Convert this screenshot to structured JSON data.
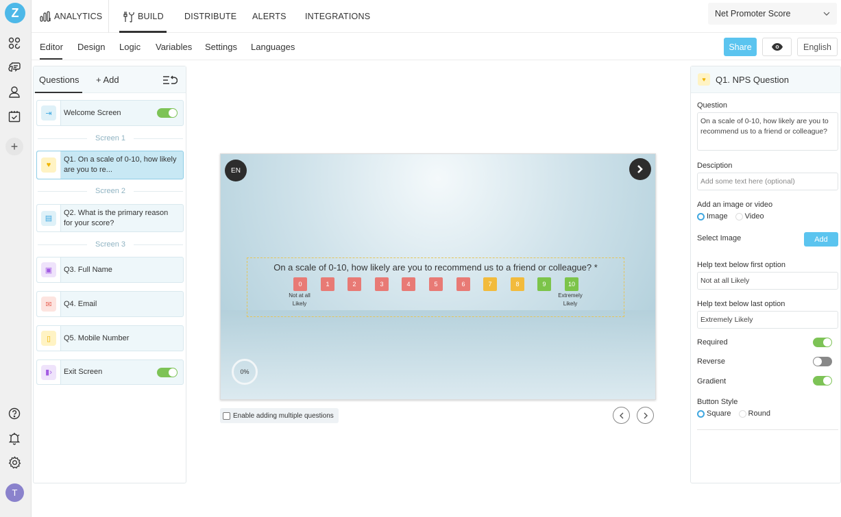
{
  "rail": {
    "logo_letter": "Z",
    "icons": [
      "dashboard-icon",
      "feedback-icon",
      "contacts-icon",
      "tasks-icon",
      "add-icon",
      "help-icon",
      "notifications-icon",
      "settings-icon"
    ],
    "avatar_initial": "T"
  },
  "topnav": {
    "items": [
      {
        "label": "ANALYTICS",
        "icon": "analytics-icon"
      },
      {
        "label": "BUILD",
        "icon": "build-tools-icon",
        "active": true
      },
      {
        "label": "DISTRIBUTE"
      },
      {
        "label": "ALERTS"
      },
      {
        "label": "INTEGRATIONS"
      }
    ],
    "survey_select": {
      "value": "Net Promoter Score"
    }
  },
  "subnav": {
    "tabs": [
      {
        "label": "Editor",
        "active": true
      },
      {
        "label": "Design"
      },
      {
        "label": "Logic"
      },
      {
        "label": "Variables"
      },
      {
        "label": "Settings"
      },
      {
        "label": "Languages"
      }
    ],
    "share_label": "Share",
    "language_label": "English"
  },
  "questions_panel": {
    "tab_questions": "Questions",
    "tab_add": "+ Add",
    "items": [
      {
        "label": "Welcome Screen",
        "icon": "welcome-icon",
        "toggle": true
      },
      {
        "divider": "Screen 1"
      },
      {
        "label": "Q1. On a scale of 0-10, how likely are you to re...",
        "icon": "heart-icon",
        "selected": true
      },
      {
        "divider": "Screen 2"
      },
      {
        "label": "Q2. What is the primary reason for your score?",
        "icon": "text-box-icon"
      },
      {
        "divider": "Screen 3"
      },
      {
        "label": "Q3. Full Name",
        "icon": "id-card-icon"
      },
      {
        "label": "Q4. Email",
        "icon": "email-icon"
      },
      {
        "label": "Q5. Mobile Number",
        "icon": "phone-icon"
      },
      {
        "label": "Exit Screen",
        "icon": "exit-icon",
        "toggle": true
      }
    ]
  },
  "preview": {
    "language_badge": "EN",
    "question": "On a scale of 0-10, how likely are you to recommend us to a friend or colleague? *",
    "scale": [
      {
        "value": "0",
        "color": "#e87a75"
      },
      {
        "value": "1",
        "color": "#e87a75"
      },
      {
        "value": "2",
        "color": "#e87a75"
      },
      {
        "value": "3",
        "color": "#e87a75"
      },
      {
        "value": "4",
        "color": "#e87a75"
      },
      {
        "value": "5",
        "color": "#e87a75"
      },
      {
        "value": "6",
        "color": "#e87a75"
      },
      {
        "value": "7",
        "color": "#f2bb3c"
      },
      {
        "value": "8",
        "color": "#f2bb3c"
      },
      {
        "value": "9",
        "color": "#7cc44a"
      },
      {
        "value": "10",
        "color": "#7cc44a"
      }
    ],
    "low_label_1": "Not at all",
    "low_label_2": "Likely",
    "high_label_1": "Extremely",
    "high_label_2": "Likely",
    "progress": "0%",
    "multi_questions_label": "Enable adding multiple questions"
  },
  "properties": {
    "title": "Q1. NPS Question",
    "question_label": "Question",
    "question_value": "On a scale of 0-10, how likely are you to recommend us to a friend or colleague?",
    "description_label": "Desciption",
    "description_placeholder": "Add some text here (optional)",
    "media_label": "Add an image or video",
    "media_options": [
      "Image",
      "Video"
    ],
    "media_selected": "Image",
    "select_image_label": "Select Image",
    "add_label": "Add",
    "help_first_label": "Help text below first option",
    "help_first_value": "Not at all Likely",
    "help_last_label": "Help text below last option",
    "help_last_value": "Extremely Likely",
    "required_label": "Required",
    "required": true,
    "reverse_label": "Reverse",
    "reverse": false,
    "gradient_label": "Gradient",
    "gradient": true,
    "button_style_label": "Button Style",
    "button_style_options": [
      "Square",
      "Round"
    ],
    "button_style_selected": "Square"
  }
}
